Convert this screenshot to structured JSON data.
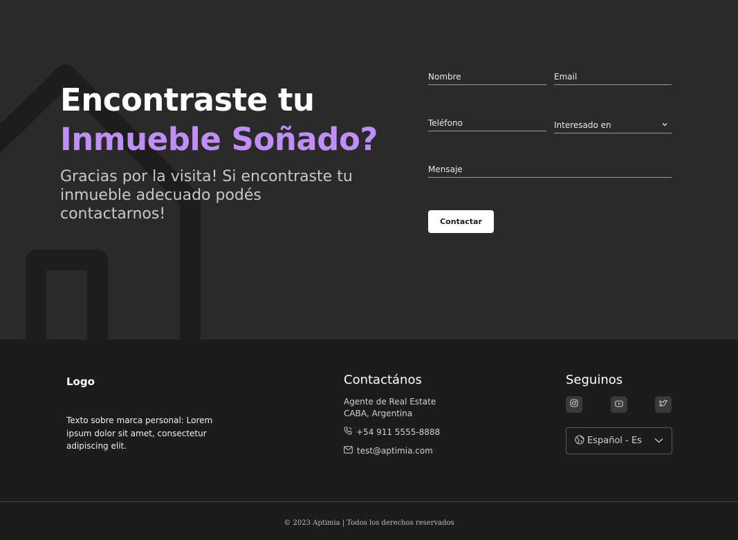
{
  "hero": {
    "title_line1": "Encontraste tu",
    "title_line2": "Inmueble Soñado?",
    "subtitle": "Gracias por la visita! Si encontraste tu inmueble adecuado podés contactarnos!"
  },
  "form": {
    "name_label": "Nombre",
    "email_label": "Email",
    "phone_label": "Teléfono",
    "interest_label": "Interesado en",
    "message_label": "Mensaje",
    "submit_label": "Contactar"
  },
  "footer": {
    "logo": "Logo",
    "brand_text": "Texto sobre marca personal: Lorem ipsum dolor sit amet, consectetur adipiscing elit.",
    "contact_title": "Contactános",
    "agent_line1": "Agente de Real Estate",
    "agent_line2": "CABA, Argentina",
    "phone": "+54 911 5555-8888",
    "email": "test@aptimia.com",
    "social_title": "Seguinos",
    "language": "Español - Es",
    "copyright": "© 2023 Aptimia | Todos los derechos reservados"
  },
  "colors": {
    "accent": "#c08ef7",
    "hero_bg": "#2a2a2a",
    "footer_bg": "#1c1c1c"
  },
  "icons": [
    "phone-icon",
    "mail-icon",
    "instagram-icon",
    "youtube-icon",
    "twitter-icon",
    "globe-icon",
    "chevron-down-icon"
  ]
}
